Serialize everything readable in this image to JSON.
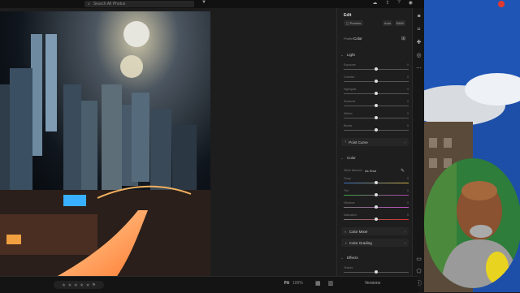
{
  "app": {
    "search_placeholder": "Search All Photos",
    "top_icons": [
      "cloud-sync-icon",
      "share-icon",
      "help-icon",
      "notification-icon"
    ]
  },
  "editor": {
    "title": "Edit",
    "profile_row": {
      "auto_label": "Auto",
      "bw_label": "B&W",
      "profile_prefix": "Profile",
      "profile_value": "Color"
    },
    "light": {
      "title": "Light",
      "sliders": [
        {
          "label": "Exposure",
          "value": 0
        },
        {
          "label": "Contrast",
          "value": 0
        },
        {
          "label": "Highlights",
          "value": 0
        },
        {
          "label": "Shadows",
          "value": 0
        },
        {
          "label": "Whites",
          "value": 0
        },
        {
          "label": "Blacks",
          "value": 0
        }
      ],
      "point_curve": "Point Curve"
    },
    "color": {
      "title": "Color",
      "white_balance_label": "White Balance",
      "white_balance_value": "As Shot",
      "sliders": [
        {
          "label": "Temp",
          "value": 0
        },
        {
          "label": "Tint",
          "value": 0
        },
        {
          "label": "Vibrance",
          "value": 0
        },
        {
          "label": "Saturation",
          "value": 0
        }
      ],
      "color_mixer": "Color Mixer",
      "color_grading": "Color Grading"
    },
    "effects": {
      "title": "Effects",
      "first_slider": "Texture"
    }
  },
  "bottom": {
    "fit_label": "Fit",
    "zoom_value": "100%",
    "versions_label": "Versions"
  },
  "colors": {
    "panel_bg": "#1e1e1e",
    "app_bg": "#1a1a1a",
    "accent": "#ffffff"
  }
}
